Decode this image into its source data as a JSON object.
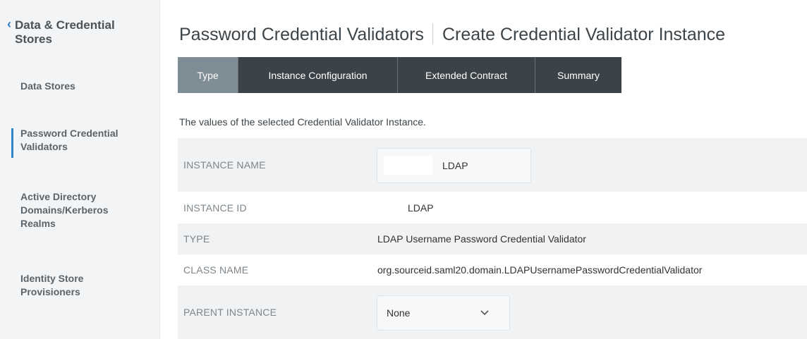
{
  "sidebar": {
    "back_title": "Data & Credential Stores",
    "items": [
      {
        "label": "Data Stores"
      },
      {
        "label": "Password Credential Validators",
        "active": true
      },
      {
        "label": "Active Directory Domains/Kerberos Realms"
      },
      {
        "label": "Identity Store Provisioners"
      }
    ]
  },
  "header": {
    "section": "Password Credential Validators",
    "page": "Create Credential Validator Instance"
  },
  "tabs": [
    {
      "label": "Type",
      "active": true
    },
    {
      "label": "Instance Configuration"
    },
    {
      "label": "Extended Contract"
    },
    {
      "label": "Summary"
    }
  ],
  "intro": "The values of the selected Credential Validator Instance.",
  "fields": {
    "instance_name": {
      "label": "INSTANCE NAME",
      "value": "LDAP"
    },
    "instance_id": {
      "label": "INSTANCE ID",
      "value": "LDAP"
    },
    "type": {
      "label": "TYPE",
      "value": "LDAP Username Password Credential Validator"
    },
    "class_name": {
      "label": "CLASS NAME",
      "value": "org.sourceid.saml20.domain.LDAPUsernamePasswordCredentialValidator"
    },
    "parent_instance": {
      "label": "PARENT INSTANCE",
      "value": "None"
    }
  },
  "colors": {
    "tab_bg": "#3b4348",
    "tab_active_bg": "#7e8d96",
    "accent": "#2e88c9"
  },
  "icons": {
    "back": "chevron-left-icon",
    "select": "chevron-down-icon"
  }
}
